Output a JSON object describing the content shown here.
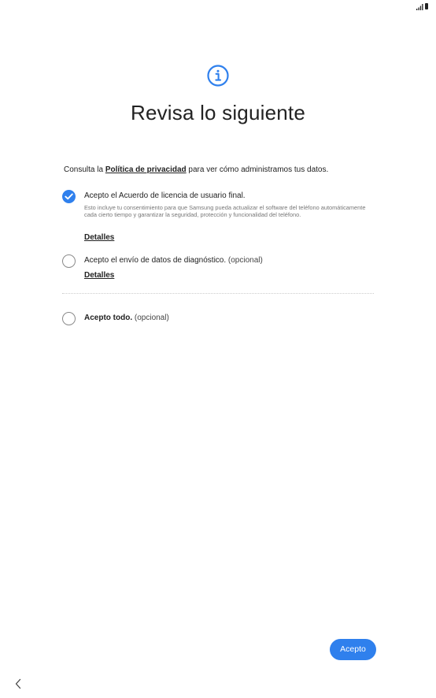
{
  "header": {
    "title": "Revisa lo siguiente"
  },
  "intro": {
    "prefix": "Consulta la ",
    "link": "Política de privacidad",
    "suffix": " para ver cómo administramos tus datos."
  },
  "options": [
    {
      "label": "Acepto el Acuerdo de licencia de usuario final.",
      "description": "Esto incluye tu consentimiento para que Samsung pueda actualizar el software del teléfono automáticamente cada cierto tiempo y garantizar la seguridad, protección y funcionalidad del teléfono.",
      "details_label": "Detalles",
      "checked": true
    },
    {
      "label": "Acepto el envío de datos de diagnóstico.",
      "optional_label": " (opcional)",
      "details_label": "Detalles",
      "checked": false
    },
    {
      "label": "Acepto todo.",
      "optional_label": " (opcional)",
      "checked": false
    }
  ],
  "footer": {
    "accept_label": "Acepto"
  },
  "icons": {
    "info": "info-icon",
    "checkmark": "checkmark-icon",
    "back": "back-chevron-icon",
    "signal": "signal-icon",
    "battery": "battery-icon"
  },
  "colors": {
    "accent": "#2f80ed",
    "text": "#222222",
    "muted": "#777777"
  }
}
